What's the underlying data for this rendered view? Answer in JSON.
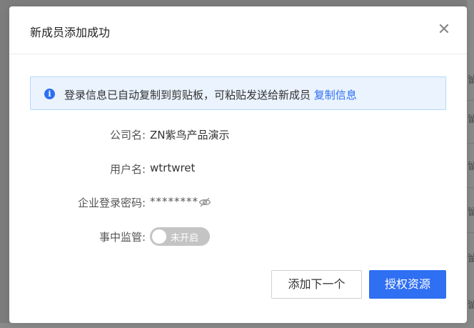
{
  "dialog": {
    "title": "新成员添加成功",
    "close_icon": "close-icon"
  },
  "alert": {
    "icon": "info-icon",
    "message": "登录信息已自动复制到剪贴板，可粘贴发送给新成员",
    "link": "复制信息"
  },
  "fields": {
    "company": {
      "label": "公司名:",
      "value": "ZN紫鸟产品演示"
    },
    "username": {
      "label": "用户名:",
      "value": "wtrtwret"
    },
    "password": {
      "label": "企业登录密码:",
      "value": "********",
      "icon": "eye-hidden-icon"
    },
    "supervision": {
      "label": "事中监管:",
      "toggle_text": "未开启",
      "enabled": false
    }
  },
  "buttons": {
    "add_next": "添加下一个",
    "authorize": "授权资源"
  },
  "background": {
    "column_char": "留"
  },
  "colors": {
    "primary": "#2f6ff2",
    "alert_bg": "#eaf3fe",
    "alert_border": "#b9d7fb",
    "toggle_off": "#c4c4c4"
  }
}
